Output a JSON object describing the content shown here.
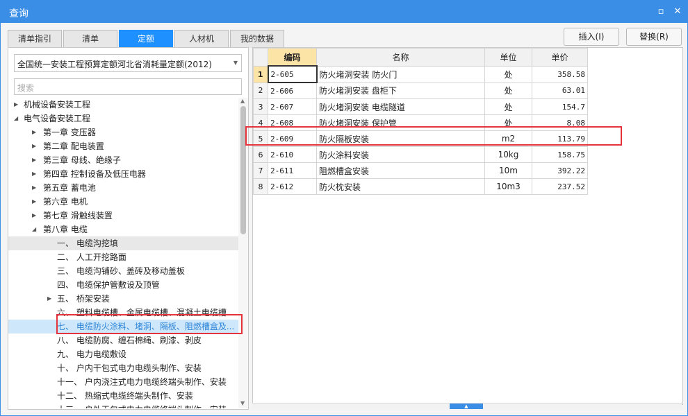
{
  "window": {
    "title": "查询",
    "restore_icon": "restore-icon",
    "close_icon": "close-icon"
  },
  "tabs": [
    {
      "label": "清单指引"
    },
    {
      "label": "清单"
    },
    {
      "label": "定额",
      "active": true
    },
    {
      "label": "人材机"
    },
    {
      "label": "我的数据"
    }
  ],
  "buttons": {
    "insert": "插入(I)",
    "replace": "替换(R)"
  },
  "left": {
    "quota_library": "全国统一安装工程预算定额河北省消耗量定额(2012)",
    "search_placeholder": "搜索",
    "tree": [
      {
        "label": "机械设备安装工程",
        "level": 0,
        "arrow": "right"
      },
      {
        "label": "电气设备安装工程",
        "level": 0,
        "arrow": "down"
      },
      {
        "label": "第一章 变压器",
        "level": 1,
        "arrow": "right"
      },
      {
        "label": "第二章 配电装置",
        "level": 1,
        "arrow": "right"
      },
      {
        "label": "第三章 母线、绝缘子",
        "level": 1,
        "arrow": "right"
      },
      {
        "label": "第四章 控制设备及低压电器",
        "level": 1,
        "arrow": "right"
      },
      {
        "label": "第五章 蓄电池",
        "level": 1,
        "arrow": "right"
      },
      {
        "label": "第六章 电机",
        "level": 1,
        "arrow": "right"
      },
      {
        "label": "第七章 滑触线装置",
        "level": 1,
        "arrow": "right"
      },
      {
        "label": "第八章 电缆",
        "level": 1,
        "arrow": "down"
      },
      {
        "label": "一、 电缆沟挖填",
        "level": 2,
        "arrow": "",
        "state": "grey"
      },
      {
        "label": "二、 人工开挖路面",
        "level": 2,
        "arrow": ""
      },
      {
        "label": "三、 电缆沟铺砂、盖砖及移动盖板",
        "level": 2,
        "arrow": ""
      },
      {
        "label": "四、 电缆保护管敷设及顶管",
        "level": 2,
        "arrow": ""
      },
      {
        "label": "五、 桥架安装",
        "level": 2,
        "arrow": "right"
      },
      {
        "label": "六、 塑料电缆槽、金属电缆槽、混凝土电缆槽...",
        "level": 2,
        "arrow": ""
      },
      {
        "label": "七、 电缆防火涂料、堵洞、隔板、阻燃槽盒及...",
        "level": 2,
        "arrow": "",
        "state": "selected"
      },
      {
        "label": "八、 电缆防腐、缠石棉绳、刷漆、剥皮",
        "level": 2,
        "arrow": ""
      },
      {
        "label": "九、 电力电缆敷设",
        "level": 2,
        "arrow": ""
      },
      {
        "label": "十、 户内干包式电力电缆头制作、安装",
        "level": 2,
        "arrow": ""
      },
      {
        "label": "十一、 户内浇注式电力电缆终端头制作、安装",
        "level": 2,
        "arrow": ""
      },
      {
        "label": "十二、 热缩式电缆终端头制作、安装",
        "level": 2,
        "arrow": ""
      },
      {
        "label": "十三、 户外干包式电力电缆终端头制作、安装",
        "level": 2,
        "arrow": ""
      }
    ]
  },
  "grid": {
    "headers": {
      "index": "",
      "code": "编码",
      "name": "名称",
      "unit": "单位",
      "price": "单价"
    },
    "rows": [
      {
        "index": "1",
        "code": "2-605",
        "name": "防火堵洞安装 防火门",
        "unit": "处",
        "price": "358.58"
      },
      {
        "index": "2",
        "code": "2-606",
        "name": "防火堵洞安装 盘柜下",
        "unit": "处",
        "price": "63.01"
      },
      {
        "index": "3",
        "code": "2-607",
        "name": "防火堵洞安装 电缆隧道",
        "unit": "处",
        "price": "154.7"
      },
      {
        "index": "4",
        "code": "2-608",
        "name": "防火堵洞安装 保护管",
        "unit": "处",
        "price": "8.08"
      },
      {
        "index": "5",
        "code": "2-609",
        "name": "防火隔板安装",
        "unit": "m2",
        "price": "113.79"
      },
      {
        "index": "6",
        "code": "2-610",
        "name": "防火涂料安装",
        "unit": "10kg",
        "price": "158.75"
      },
      {
        "index": "7",
        "code": "2-611",
        "name": "阻燃槽盒安装",
        "unit": "10m",
        "price": "392.22"
      },
      {
        "index": "8",
        "code": "2-612",
        "name": "防火枕安装",
        "unit": "10m3",
        "price": "237.52"
      }
    ]
  },
  "colors": {
    "accent": "#3a8ee6",
    "highlight_box": "#e5333b",
    "selected_header": "#fce4a6"
  }
}
